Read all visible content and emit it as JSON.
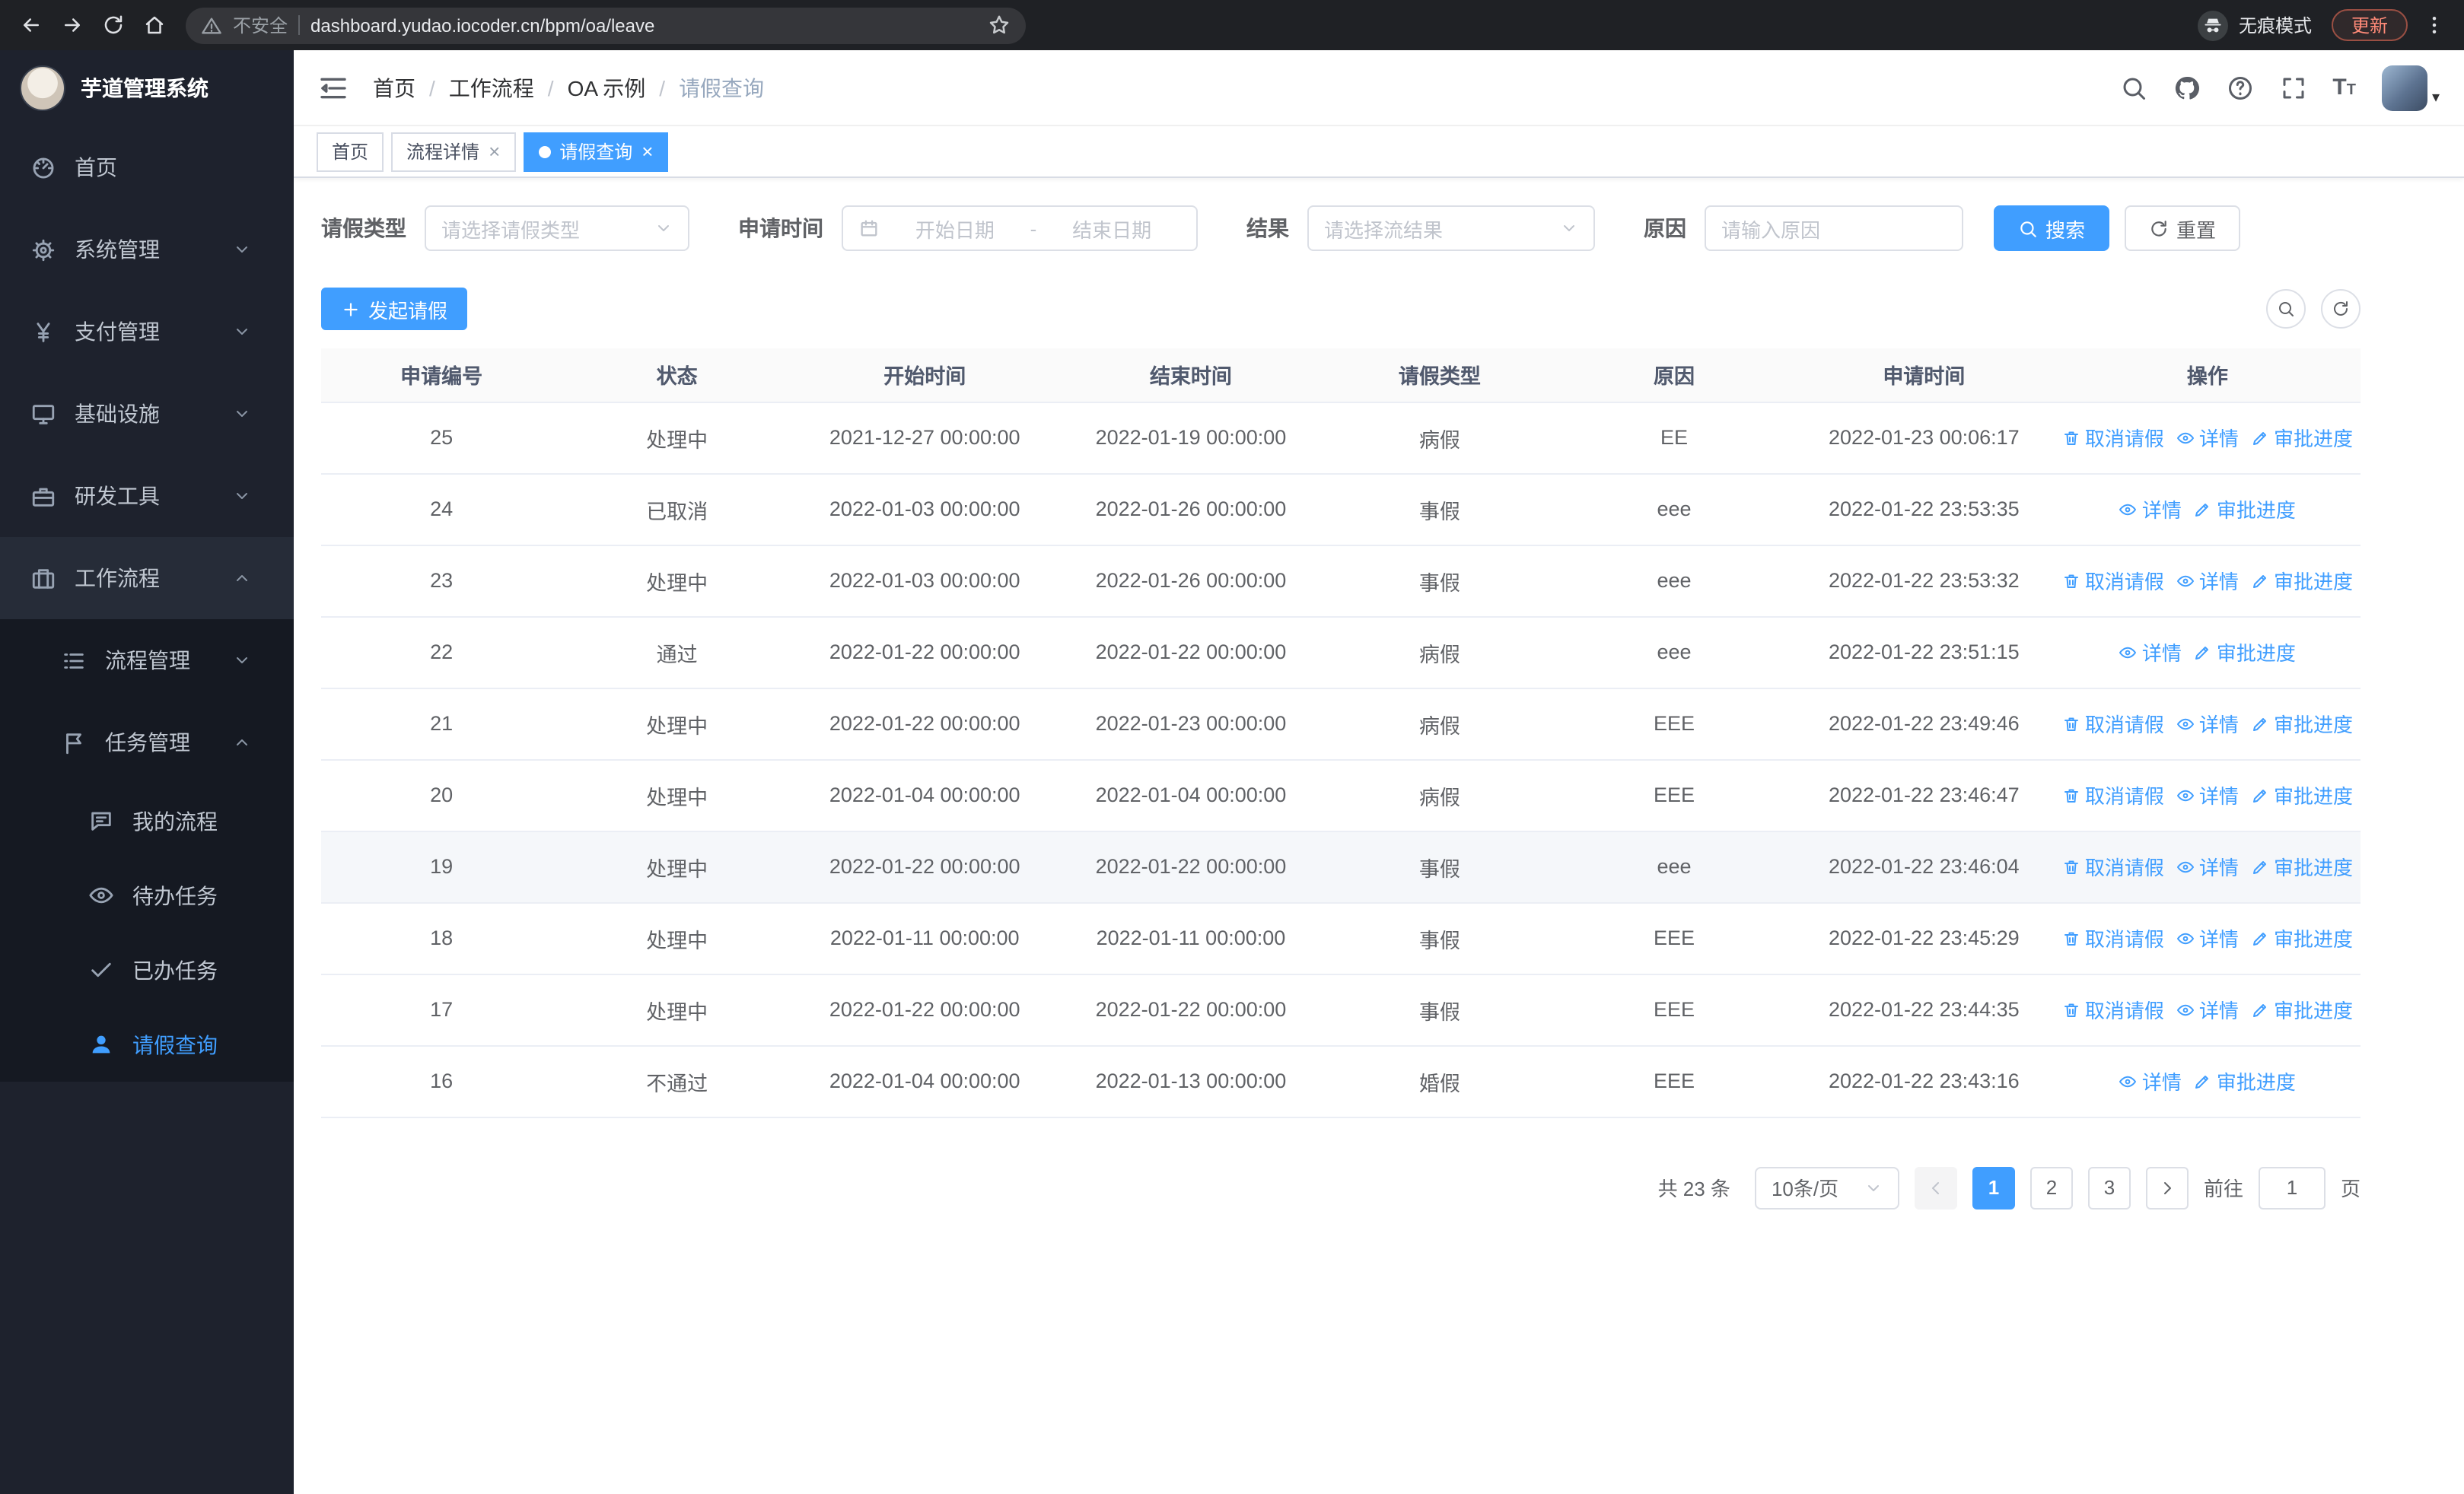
{
  "browser": {
    "security_warning": "不安全",
    "url": "dashboard.yudao.iocoder.cn/bpm/oa/leave",
    "incognito_label": "无痕模式",
    "update_label": "更新"
  },
  "app": {
    "logo_title": "芋道管理系统"
  },
  "sidebar": {
    "items": [
      {
        "key": "home",
        "label": "首页",
        "icon": "dashboard",
        "depth": 1
      },
      {
        "key": "system-management",
        "label": "系统管理",
        "icon": "gear",
        "depth": 1,
        "chevron": "down"
      },
      {
        "key": "payment-management",
        "label": "支付管理",
        "icon": "yen",
        "depth": 1,
        "chevron": "down"
      },
      {
        "key": "infrastructure",
        "label": "基础设施",
        "icon": "monitor",
        "depth": 1,
        "chevron": "down"
      },
      {
        "key": "dev-tools",
        "label": "研发工具",
        "icon": "briefcase",
        "depth": 1,
        "chevron": "down"
      },
      {
        "key": "workflow",
        "label": "工作流程",
        "icon": "suitcase",
        "depth": 1,
        "chevron": "up",
        "expanded": true
      },
      {
        "key": "process-management",
        "label": "流程管理",
        "icon": "list",
        "depth": 2,
        "chevron": "down"
      },
      {
        "key": "task-management",
        "label": "任务管理",
        "icon": "flag",
        "depth": 2,
        "chevron": "up",
        "expanded": true
      },
      {
        "key": "my-processes",
        "label": "我的流程",
        "icon": "chat",
        "depth": 3
      },
      {
        "key": "todo-tasks",
        "label": "待办任务",
        "icon": "eye",
        "depth": 3
      },
      {
        "key": "done-tasks",
        "label": "已办任务",
        "icon": "check",
        "depth": 3
      },
      {
        "key": "leave-query",
        "label": "请假查询",
        "icon": "user",
        "depth": 3,
        "active": true
      }
    ]
  },
  "breadcrumb": [
    "首页",
    "工作流程",
    "OA 示例",
    "请假查询"
  ],
  "tabs": [
    {
      "key": "home",
      "label": "首页",
      "closable": false,
      "active": false
    },
    {
      "key": "process-detail",
      "label": "流程详情",
      "closable": true,
      "active": false
    },
    {
      "key": "leave-query",
      "label": "请假查询",
      "closable": true,
      "active": true
    }
  ],
  "filters": {
    "leave_type_label": "请假类型",
    "leave_type_placeholder": "请选择请假类型",
    "apply_time_label": "申请时间",
    "start_date_placeholder": "开始日期",
    "date_separator": "-",
    "end_date_placeholder": "结束日期",
    "result_label": "结果",
    "result_placeholder": "请选择流结果",
    "reason_label": "原因",
    "reason_placeholder": "请输入原因",
    "search_button": "搜索",
    "reset_button": "重置"
  },
  "toolbar": {
    "create_button": "发起请假"
  },
  "table": {
    "columns": [
      "申请编号",
      "状态",
      "开始时间",
      "结束时间",
      "请假类型",
      "原因",
      "申请时间",
      "操作"
    ],
    "action_labels": {
      "cancel": "取消请假",
      "detail": "详情",
      "progress": "审批进度"
    },
    "rows": [
      {
        "id": "25",
        "status": "处理中",
        "start": "2021-12-27 00:00:00",
        "end": "2022-01-19 00:00:00",
        "type": "病假",
        "reason": "EE",
        "applied": "2022-01-23 00:06:17",
        "actions": [
          "cancel",
          "detail",
          "progress"
        ]
      },
      {
        "id": "24",
        "status": "已取消",
        "start": "2022-01-03 00:00:00",
        "end": "2022-01-26 00:00:00",
        "type": "事假",
        "reason": "eee",
        "applied": "2022-01-22 23:53:35",
        "actions": [
          "detail",
          "progress"
        ]
      },
      {
        "id": "23",
        "status": "处理中",
        "start": "2022-01-03 00:00:00",
        "end": "2022-01-26 00:00:00",
        "type": "事假",
        "reason": "eee",
        "applied": "2022-01-22 23:53:32",
        "actions": [
          "cancel",
          "detail",
          "progress"
        ]
      },
      {
        "id": "22",
        "status": "通过",
        "start": "2022-01-22 00:00:00",
        "end": "2022-01-22 00:00:00",
        "type": "病假",
        "reason": "eee",
        "applied": "2022-01-22 23:51:15",
        "actions": [
          "detail",
          "progress"
        ]
      },
      {
        "id": "21",
        "status": "处理中",
        "start": "2022-01-22 00:00:00",
        "end": "2022-01-23 00:00:00",
        "type": "病假",
        "reason": "EEE",
        "applied": "2022-01-22 23:49:46",
        "actions": [
          "cancel",
          "detail",
          "progress"
        ]
      },
      {
        "id": "20",
        "status": "处理中",
        "start": "2022-01-04 00:00:00",
        "end": "2022-01-04 00:00:00",
        "type": "病假",
        "reason": "EEE",
        "applied": "2022-01-22 23:46:47",
        "actions": [
          "cancel",
          "detail",
          "progress"
        ]
      },
      {
        "id": "19",
        "status": "处理中",
        "start": "2022-01-22 00:00:00",
        "end": "2022-01-22 00:00:00",
        "type": "事假",
        "reason": "eee",
        "applied": "2022-01-22 23:46:04",
        "actions": [
          "cancel",
          "detail",
          "progress"
        ],
        "hover": true
      },
      {
        "id": "18",
        "status": "处理中",
        "start": "2022-01-11 00:00:00",
        "end": "2022-01-11 00:00:00",
        "type": "事假",
        "reason": "EEE",
        "applied": "2022-01-22 23:45:29",
        "actions": [
          "cancel",
          "detail",
          "progress"
        ]
      },
      {
        "id": "17",
        "status": "处理中",
        "start": "2022-01-22 00:00:00",
        "end": "2022-01-22 00:00:00",
        "type": "事假",
        "reason": "EEE",
        "applied": "2022-01-22 23:44:35",
        "actions": [
          "cancel",
          "detail",
          "progress"
        ]
      },
      {
        "id": "16",
        "status": "不通过",
        "start": "2022-01-04 00:00:00",
        "end": "2022-01-13 00:00:00",
        "type": "婚假",
        "reason": "EEE",
        "applied": "2022-01-22 23:43:16",
        "actions": [
          "detail",
          "progress"
        ]
      }
    ]
  },
  "pagination": {
    "total_label": "共 23 条",
    "page_size": "10条/页",
    "pages": [
      {
        "label": "1",
        "active": true
      },
      {
        "label": "2",
        "active": false
      },
      {
        "label": "3",
        "active": false
      }
    ],
    "goto_label": "前往",
    "goto_value": "1",
    "page_label": "页"
  },
  "colors": {
    "accent": "#409eff",
    "sidebar_bg": "#1e222d",
    "active_tab_bg": "#409eff"
  }
}
